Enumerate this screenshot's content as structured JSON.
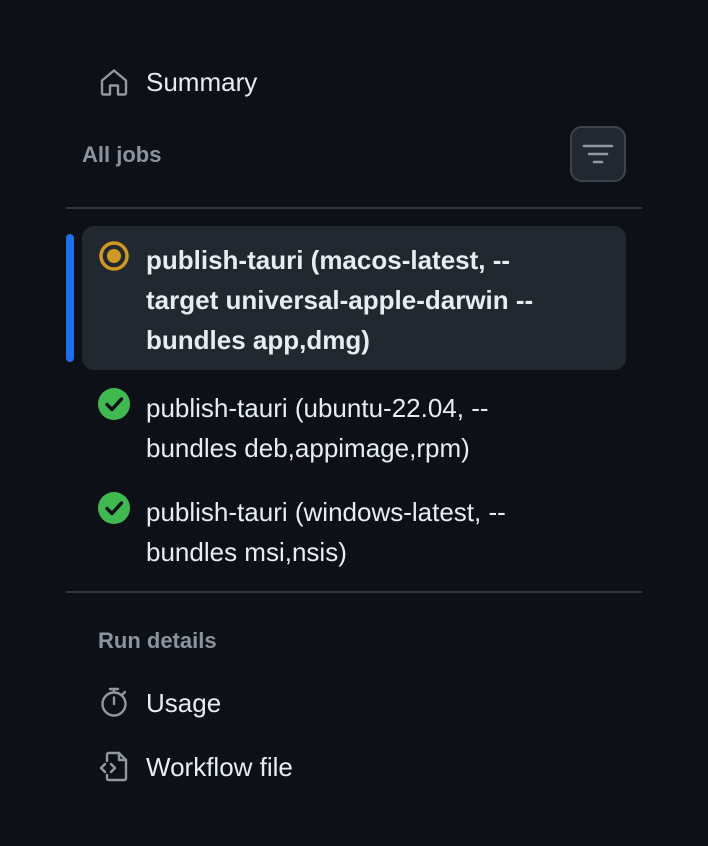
{
  "summary": {
    "label": "Summary",
    "icon": "home-icon"
  },
  "jobs_section": {
    "heading": "All jobs",
    "filter_icon": "filter-icon"
  },
  "jobs": [
    {
      "label": "publish-tauri (macos-latest, --\ntarget universal-apple-darwin --\nbundles app,dmg)",
      "status": "in-progress",
      "status_icon": "in-progress-icon",
      "active": true
    },
    {
      "label": "publish-tauri (ubuntu-22.04, --\nbundles deb,appimage,rpm)",
      "status": "success",
      "status_icon": "check-circle-icon",
      "active": false
    },
    {
      "label": "publish-tauri (windows-latest, --\nbundles msi,nsis)",
      "status": "success",
      "status_icon": "check-circle-icon",
      "active": false
    }
  ],
  "run_details": {
    "heading": "Run details",
    "items": [
      {
        "label": "Usage",
        "icon": "stopwatch-icon"
      },
      {
        "label": "Workflow file",
        "icon": "file-code-icon"
      }
    ]
  },
  "colors": {
    "background": "#0d1117",
    "accent": "#1f6feb",
    "success": "#3fb950",
    "in_progress": "#d29922",
    "muted_text": "#8b949e"
  }
}
